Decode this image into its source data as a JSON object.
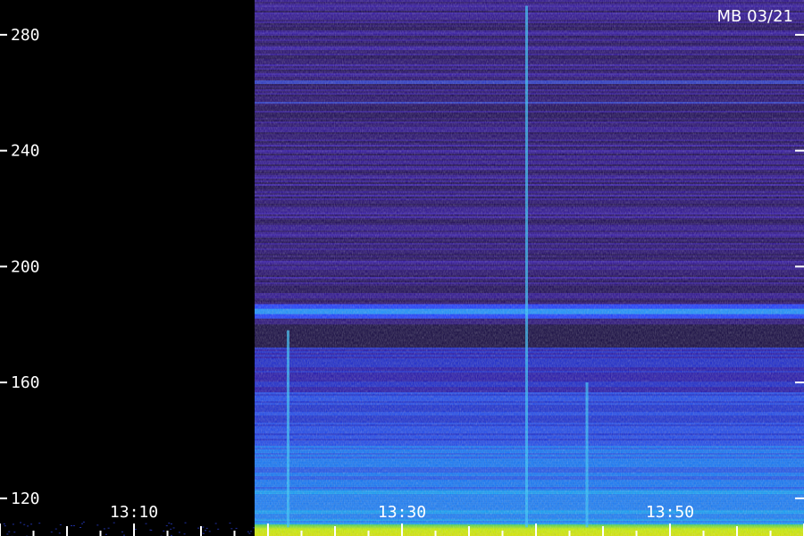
{
  "chart_data": {
    "type": "heatmap",
    "title": "MB 03/21",
    "xlabel": "",
    "ylabel": "",
    "y_ticks": [
      "280",
      "240",
      "200",
      "160",
      "120"
    ],
    "y_tick_values": [
      280,
      240,
      200,
      160,
      120
    ],
    "ylim": [
      107,
      292
    ],
    "x_ticks": [
      "13:10",
      "13:30",
      "13:50"
    ],
    "x_tick_values": [
      10,
      30,
      50
    ],
    "xlim": [
      0,
      60
    ],
    "data_start": 19,
    "series": [
      {
        "name": "",
        "band": "background",
        "y_range": [
          182,
          292
        ],
        "level": 0.22
      },
      {
        "name": "",
        "band": "strong horizontal line",
        "y_center": 184.5,
        "level": 0.55
      },
      {
        "name": "",
        "band": "mid band",
        "y_range": [
          120,
          180
        ],
        "level": 0.4
      },
      {
        "name": "",
        "band": "low band",
        "y_range": [
          107,
          111
        ],
        "level": 0.85
      },
      {
        "name": "",
        "band": "vertical burst",
        "x": 21.5,
        "y_range": [
          110,
          178
        ],
        "level": 0.6
      },
      {
        "name": "",
        "band": "vertical burst",
        "x": 39.3,
        "y_range": [
          110,
          290
        ],
        "level": 0.55
      },
      {
        "name": "",
        "band": "vertical burst",
        "x": 43.8,
        "y_range": [
          110,
          160
        ],
        "level": 0.5
      }
    ],
    "colors": {
      "low": "#1a0a50",
      "mid": "#1c48ff",
      "high": "#00c8ff",
      "top": "#d8ff00",
      "tick": "#ffffff"
    },
    "grid": false
  }
}
